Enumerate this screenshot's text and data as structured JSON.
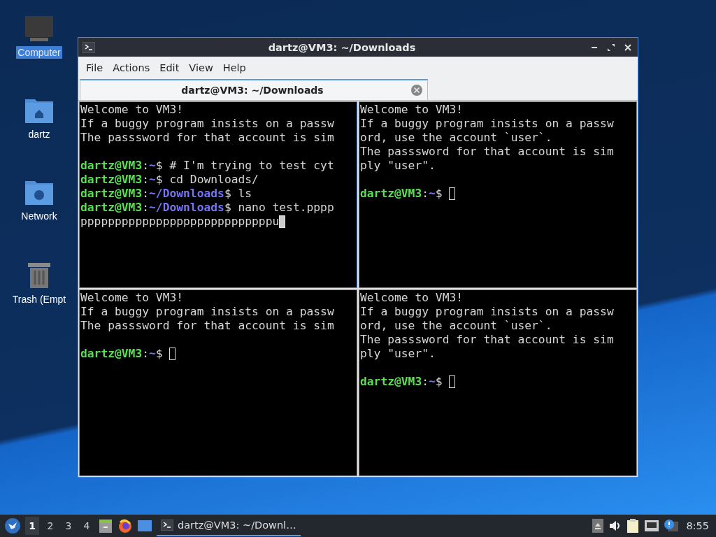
{
  "desktop_icons": [
    {
      "label": "Computer",
      "kind": "computer",
      "selected": true
    },
    {
      "label": "dartz",
      "kind": "home",
      "selected": false
    },
    {
      "label": "Network",
      "kind": "network",
      "selected": false
    },
    {
      "label": "Trash (Empt",
      "kind": "trash",
      "selected": false
    }
  ],
  "window": {
    "title": "dartz@VM3: ~/Downloads",
    "menu": [
      "File",
      "Actions",
      "Edit",
      "View",
      "Help"
    ],
    "tabs": [
      {
        "label": "dartz@VM3: ~/Downloads",
        "selected": true
      }
    ],
    "panes": [
      {
        "focused": true,
        "lines": [
          {
            "kind": "output",
            "text": "Welcome to VM3!"
          },
          {
            "kind": "output",
            "text": "If a buggy program insists on a passw"
          },
          {
            "kind": "output",
            "text": "The passsword for that account is sim"
          },
          {
            "kind": "blank"
          },
          {
            "kind": "prompt",
            "user": "dartz@VM3",
            "sep": ":",
            "path": "~",
            "command": "$ # I'm trying to test cyt"
          },
          {
            "kind": "prompt",
            "user": "dartz@VM3",
            "sep": ":",
            "path": "~",
            "command": "$ cd Downloads/"
          },
          {
            "kind": "prompt",
            "user": "dartz@VM3",
            "sep": ":",
            "path": "~/Downloads",
            "command": "$ ls"
          },
          {
            "kind": "prompt",
            "user": "dartz@VM3",
            "sep": ":",
            "path": "~/Downloads",
            "command": "$ nano test.pppp"
          },
          {
            "kind": "output",
            "text": "ppppppppppppppppppppppppppppu",
            "cursor": true
          }
        ]
      },
      {
        "focused": false,
        "lines": [
          {
            "kind": "output",
            "text": "Welcome to VM3!"
          },
          {
            "kind": "output",
            "text": "If a buggy program insists on a passw"
          },
          {
            "kind": "output",
            "text": "ord, use the account `user`."
          },
          {
            "kind": "output",
            "text": "The passsword for that account is sim"
          },
          {
            "kind": "output",
            "text": "ply \"user\"."
          },
          {
            "kind": "blank"
          },
          {
            "kind": "prompt",
            "user": "dartz@VM3",
            "sep": ":",
            "path": "~",
            "command": "$ ",
            "cursor": true
          }
        ]
      },
      {
        "focused": false,
        "lines": [
          {
            "kind": "output",
            "text": "Welcome to VM3!"
          },
          {
            "kind": "output",
            "text": "If a buggy program insists on a passw"
          },
          {
            "kind": "output",
            "text": "The passsword for that account is sim"
          },
          {
            "kind": "blank"
          },
          {
            "kind": "prompt",
            "user": "dartz@VM3",
            "sep": ":",
            "path": "~",
            "command": "$ ",
            "cursor": true
          }
        ]
      },
      {
        "focused": false,
        "lines": [
          {
            "kind": "output",
            "text": "Welcome to VM3!"
          },
          {
            "kind": "output",
            "text": "If a buggy program insists on a passw"
          },
          {
            "kind": "output",
            "text": "ord, use the account `user`."
          },
          {
            "kind": "output",
            "text": "The passsword for that account is sim"
          },
          {
            "kind": "output",
            "text": "ply \"user\"."
          },
          {
            "kind": "blank"
          },
          {
            "kind": "prompt",
            "user": "dartz@VM3",
            "sep": ":",
            "path": "~",
            "command": "$ ",
            "cursor": true
          }
        ]
      }
    ]
  },
  "taskbar": {
    "workspaces": [
      {
        "label": "1",
        "selected": true
      },
      {
        "label": "2",
        "selected": false
      },
      {
        "label": "3",
        "selected": false
      },
      {
        "label": "4",
        "selected": false
      }
    ],
    "tasks": [
      {
        "label": "dartz@VM3: ~/Downl…",
        "selected": true
      }
    ],
    "clock": "8:55"
  }
}
